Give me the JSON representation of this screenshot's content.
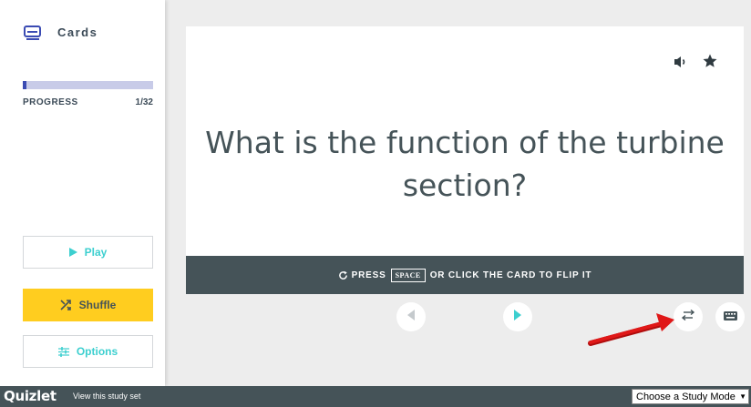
{
  "sidebar": {
    "mode_title": "Cards",
    "progress_label": "PROGRESS",
    "progress_count": "1/32",
    "progress_fraction": 0.031,
    "play_label": "Play",
    "shuffle_label": "Shuffle",
    "options_label": "Options"
  },
  "card": {
    "question": "What is the function of the turbine section?"
  },
  "flip_bar": {
    "press": "PRESS",
    "key": "SPACE",
    "rest": "OR CLICK THE CARD TO FLIP IT"
  },
  "footer": {
    "brand": "Quizlet",
    "view_link": "View this study set",
    "study_mode_select": "Choose a Study Mode"
  },
  "colors": {
    "accent_teal": "#3ccfcf",
    "shuffle_yellow": "#ffcd1f",
    "dark_slate": "#455358",
    "progress_fill": "#3b4bb3",
    "annotation_red": "#e01818"
  },
  "icons": [
    "cards-icon",
    "play-icon",
    "shuffle-icon",
    "options-icon",
    "audio-icon",
    "star-icon",
    "refresh-icon",
    "prev-arrow-icon",
    "next-arrow-icon",
    "swap-icon",
    "keyboard-icon"
  ]
}
